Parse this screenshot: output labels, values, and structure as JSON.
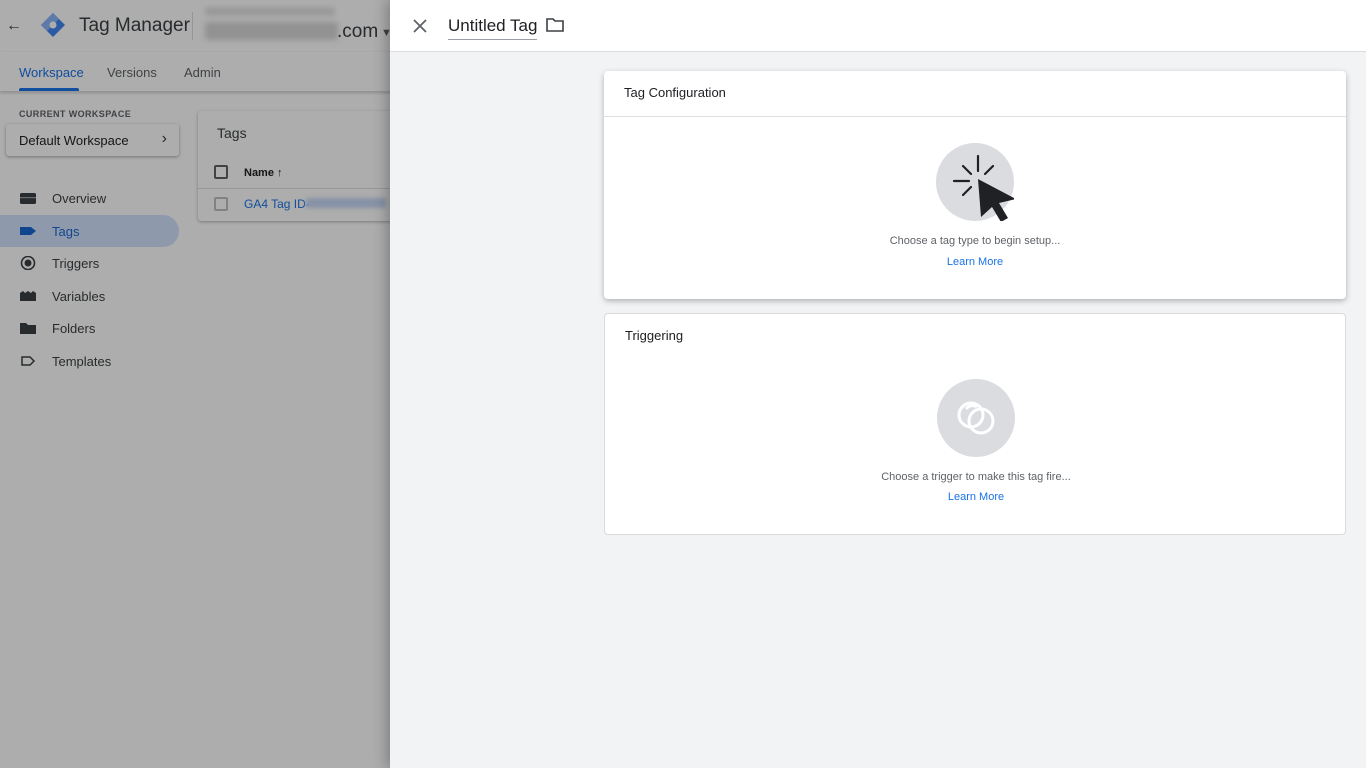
{
  "app": {
    "title": "Tag Manager",
    "container_suffix": ".com"
  },
  "tabs": [
    {
      "label": "Workspace",
      "active": true
    },
    {
      "label": "Versions",
      "active": false
    },
    {
      "label": "Admin",
      "active": false
    }
  ],
  "sidebar": {
    "workspace_label": "CURRENT WORKSPACE",
    "workspace_name": "Default Workspace",
    "items": [
      {
        "label": "Overview",
        "icon": "briefcase-icon",
        "active": false
      },
      {
        "label": "Tags",
        "icon": "tag-icon",
        "active": true
      },
      {
        "label": "Triggers",
        "icon": "trigger-icon",
        "active": false
      },
      {
        "label": "Variables",
        "icon": "variables-icon",
        "active": false
      },
      {
        "label": "Folders",
        "icon": "folder-icon",
        "active": false
      },
      {
        "label": "Templates",
        "icon": "template-icon",
        "active": false
      }
    ]
  },
  "tags_list": {
    "title": "Tags",
    "column_name": "Name ↑",
    "rows": [
      {
        "name": "GA4 Tag ID-"
      }
    ]
  },
  "sheet": {
    "title": "Untitled Tag",
    "config": {
      "title": "Tag Configuration",
      "hint": "Choose a tag type to begin setup...",
      "learn_more": "Learn More"
    },
    "trigger": {
      "title": "Triggering",
      "hint": "Choose a trigger to make this tag fire...",
      "learn_more": "Learn More"
    }
  },
  "colors": {
    "accent": "#1a73e8",
    "brand_blue": "#4285f4",
    "sheet_bg": "#f1f3f4"
  }
}
